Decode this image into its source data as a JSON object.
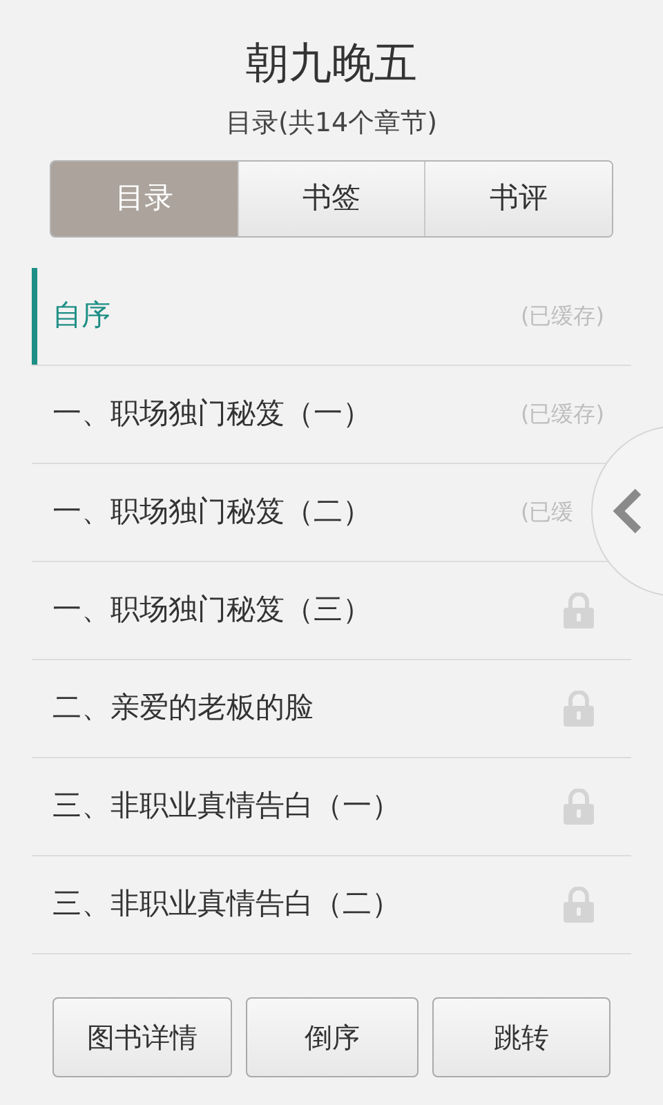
{
  "header": {
    "title": "朝九晚五",
    "subtitle": "目录(共14个章节)"
  },
  "tabs": [
    {
      "label": "目录",
      "selected": true
    },
    {
      "label": "书签",
      "selected": false
    },
    {
      "label": "书评",
      "selected": false
    }
  ],
  "chapters": [
    {
      "title": "自序",
      "selected": true,
      "kind": "cached",
      "status": "(已缓存)"
    },
    {
      "title": "一、职场独门秘笈（一）",
      "selected": false,
      "kind": "cached",
      "status": "(已缓存)"
    },
    {
      "title": "一、职场独门秘笈（二）",
      "selected": false,
      "kind": "cached",
      "status": "(已缓"
    },
    {
      "title": "一、职场独门秘笈（三）",
      "selected": false,
      "kind": "locked"
    },
    {
      "title": "二、亲爱的老板的脸",
      "selected": false,
      "kind": "locked"
    },
    {
      "title": "三、非职业真情告白（一）",
      "selected": false,
      "kind": "locked"
    },
    {
      "title": "三、非职业真情告白（二）",
      "selected": false,
      "kind": "locked"
    }
  ],
  "buttons": [
    "图书详情",
    "倒序",
    "跳转"
  ]
}
